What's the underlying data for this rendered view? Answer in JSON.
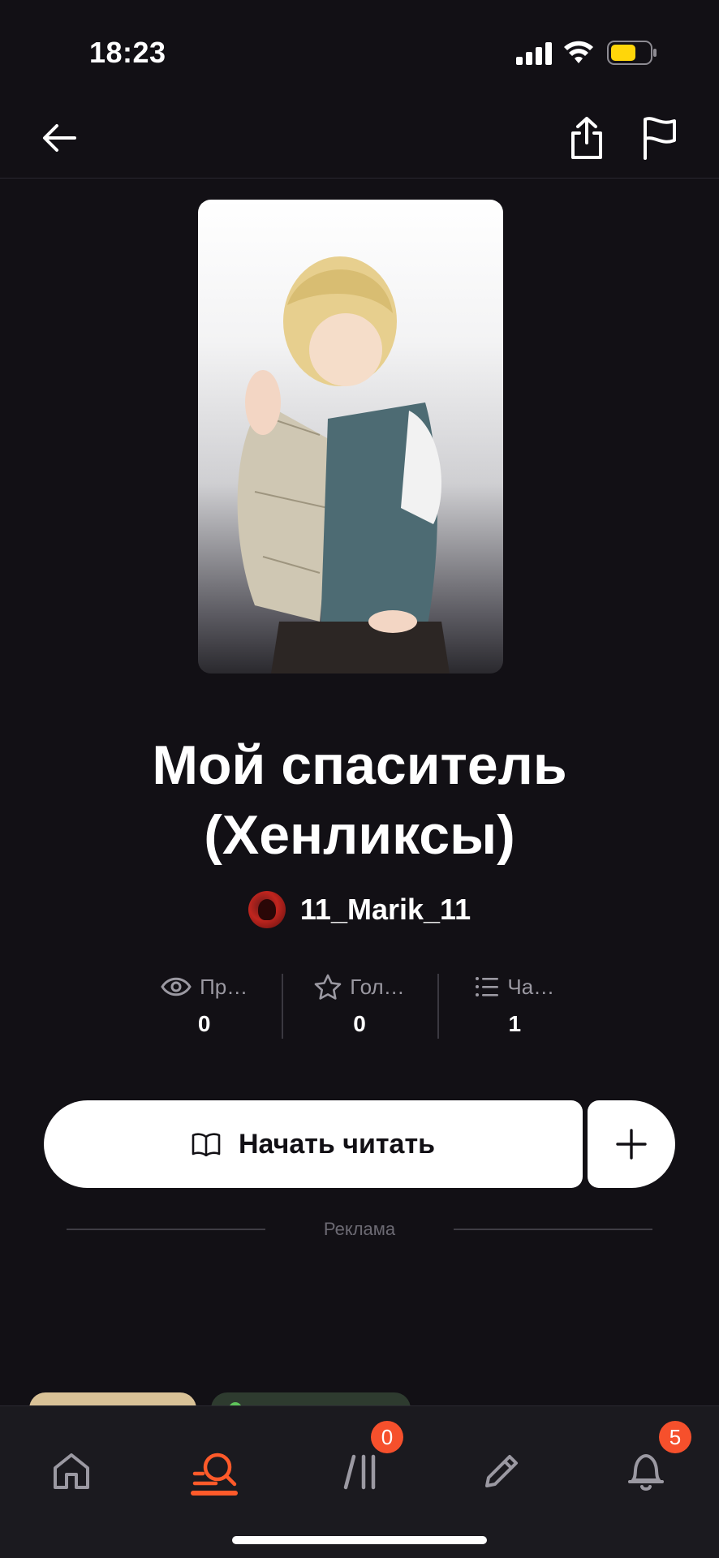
{
  "status_bar": {
    "time": "18:23",
    "icons": [
      "signal-icon",
      "wifi-icon",
      "battery-icon"
    ],
    "battery_color": "#FFD60A"
  },
  "top_nav": {
    "icons": [
      "back-arrow-icon",
      "share-icon",
      "flag-icon"
    ]
  },
  "book": {
    "title": "Мой спаситель (Хенликсы)",
    "author": "11_Marik_11"
  },
  "stats": [
    {
      "icon": "eye-icon",
      "label": "Пр…",
      "value": "0"
    },
    {
      "icon": "star-icon",
      "label": "Гол…",
      "value": "0"
    },
    {
      "icon": "list-icon",
      "label": "Ча…",
      "value": "1"
    }
  ],
  "actions": {
    "read_label": "Начать читать",
    "read_icon": "book-icon",
    "add_icon": "plus-icon"
  },
  "ad": {
    "label": "Реклама"
  },
  "tab_bar": {
    "tabs": [
      {
        "name": "home",
        "icon": "home-icon",
        "badge": null
      },
      {
        "name": "search",
        "icon": "search-icon",
        "badge": null,
        "active": true
      },
      {
        "name": "library",
        "icon": "library-icon",
        "badge": "0"
      },
      {
        "name": "write",
        "icon": "pencil-icon",
        "badge": null
      },
      {
        "name": "notifications",
        "icon": "bell-icon",
        "badge": "5"
      }
    ],
    "accent_color": "#FF5A2A"
  },
  "colors": {
    "background": "#121015",
    "accent": "#FF5A2A",
    "badge": "#F6502C"
  }
}
